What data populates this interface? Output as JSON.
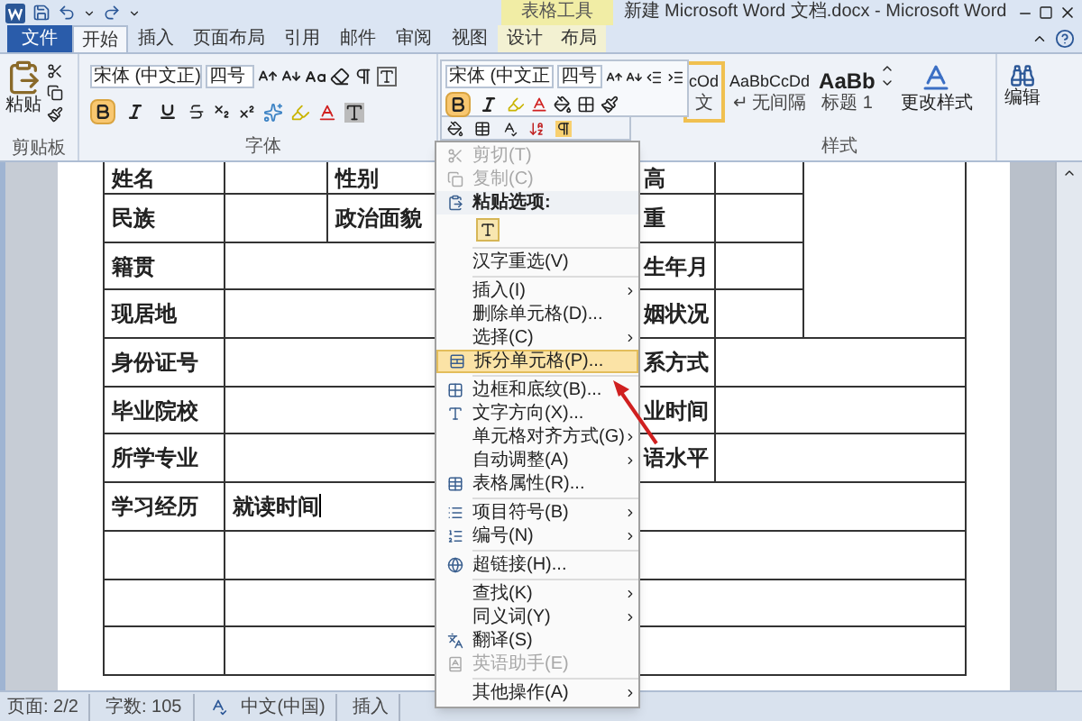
{
  "title_bar": {
    "contextual_group": "表格工具",
    "title": "新建 Microsoft Word 文档.docx - Microsoft Word"
  },
  "tabs": [
    {
      "label": "文件",
      "kind": "file",
      "selected": false
    },
    {
      "label": "开始",
      "kind": "normal",
      "selected": true
    },
    {
      "label": "插入",
      "kind": "normal",
      "selected": false
    },
    {
      "label": "页面布局",
      "kind": "normal",
      "selected": false
    },
    {
      "label": "引用",
      "kind": "normal",
      "selected": false
    },
    {
      "label": "邮件",
      "kind": "normal",
      "selected": false
    },
    {
      "label": "审阅",
      "kind": "normal",
      "selected": false
    },
    {
      "label": "视图",
      "kind": "normal",
      "selected": false
    },
    {
      "label": "设计",
      "kind": "contextual",
      "selected": false
    },
    {
      "label": "布局",
      "kind": "contextual",
      "selected": false
    }
  ],
  "ribbon": {
    "clipboard": {
      "paste": "粘贴",
      "group_label": "剪贴板"
    },
    "font": {
      "font_name": "宋体 (中文正)",
      "font_size": "四号",
      "group_label": "字体",
      "buttons": [
        {
          "kind": "bold",
          "selected": true
        },
        {
          "kind": "italic",
          "selected": false
        },
        {
          "kind": "underline",
          "selected": false
        }
      ]
    },
    "styles": {
      "items": [
        {
          "preview": "cOd",
          "name": "文",
          "selected": true
        },
        {
          "preview": "AaBbCcDd",
          "name": "↵ 无间隔",
          "selected": false
        },
        {
          "preview": "AaBb",
          "name": "标题 1",
          "selected": false
        }
      ],
      "change_styles": "更改样式",
      "group_label": "样式"
    },
    "editing": {
      "label": "编辑"
    }
  },
  "mini_toolbar": {
    "font_name": "宋体 (中文正",
    "font_size": "四号",
    "buttons": [
      {
        "kind": "bold",
        "selected": true
      },
      {
        "kind": "italic",
        "selected": false
      }
    ]
  },
  "context_menu": [
    {
      "kind": "item",
      "label": "剪切(T)",
      "disabled": true,
      "submenu": false,
      "selected": false
    },
    {
      "kind": "item",
      "label": "复制(C)",
      "disabled": true,
      "submenu": false,
      "selected": false
    },
    {
      "kind": "header",
      "label": "粘贴选项:"
    },
    {
      "kind": "paste_options"
    },
    {
      "kind": "separator"
    },
    {
      "kind": "item",
      "label": "汉字重选(V)",
      "disabled": false,
      "submenu": false,
      "selected": false
    },
    {
      "kind": "separator"
    },
    {
      "kind": "item",
      "label": "插入(I)",
      "disabled": false,
      "submenu": true,
      "selected": false
    },
    {
      "kind": "item",
      "label": "删除单元格(D)...",
      "disabled": false,
      "submenu": false,
      "selected": false
    },
    {
      "kind": "item",
      "label": "选择(C)",
      "disabled": false,
      "submenu": true,
      "selected": false
    },
    {
      "kind": "item",
      "label": "拆分单元格(P)...",
      "disabled": false,
      "submenu": false,
      "selected": true
    },
    {
      "kind": "separator"
    },
    {
      "kind": "item",
      "label": "边框和底纹(B)...",
      "disabled": false,
      "submenu": false,
      "selected": false
    },
    {
      "kind": "item",
      "label": "文字方向(X)...",
      "disabled": false,
      "submenu": false,
      "selected": false
    },
    {
      "kind": "item",
      "label": "单元格对齐方式(G)",
      "disabled": false,
      "submenu": true,
      "selected": false
    },
    {
      "kind": "item",
      "label": "自动调整(A)",
      "disabled": false,
      "submenu": true,
      "selected": false
    },
    {
      "kind": "item",
      "label": "表格属性(R)...",
      "disabled": false,
      "submenu": false,
      "selected": false
    },
    {
      "kind": "separator"
    },
    {
      "kind": "item",
      "label": "项目符号(B)",
      "disabled": false,
      "submenu": true,
      "selected": false
    },
    {
      "kind": "item",
      "label": "编号(N)",
      "disabled": false,
      "submenu": true,
      "selected": false
    },
    {
      "kind": "separator"
    },
    {
      "kind": "item",
      "label": "超链接(H)...",
      "disabled": false,
      "submenu": false,
      "selected": false
    },
    {
      "kind": "separator"
    },
    {
      "kind": "item",
      "label": "查找(K)",
      "disabled": false,
      "submenu": true,
      "selected": false
    },
    {
      "kind": "item",
      "label": "同义词(Y)",
      "disabled": false,
      "submenu": true,
      "selected": false
    },
    {
      "kind": "item",
      "label": "翻译(S)",
      "disabled": false,
      "submenu": false,
      "selected": false
    },
    {
      "kind": "item",
      "label": "英语助手(E)",
      "disabled": true,
      "submenu": false,
      "selected": false
    },
    {
      "kind": "separator"
    },
    {
      "kind": "item",
      "label": "其他操作(A)",
      "disabled": false,
      "submenu": true,
      "selected": false
    }
  ],
  "table": {
    "rows": [
      {
        "kind": "info4",
        "label": "姓名",
        "label2": "性别",
        "label3": "高"
      },
      {
        "kind": "info4",
        "label": "民族",
        "label2": "政治面貌",
        "label3": "重"
      },
      {
        "kind": "info3_photo",
        "label": "籍贯",
        "label3": "生年月"
      },
      {
        "kind": "info3_photo",
        "label": "现居地",
        "label3": "姻状况"
      },
      {
        "kind": "info3",
        "label": "身份证号",
        "label3": "系方式"
      },
      {
        "kind": "info3",
        "label": "毕业院校",
        "label3": "业时间"
      },
      {
        "kind": "info3",
        "label": "所学专业",
        "label3": "语水平"
      },
      {
        "kind": "wide",
        "label": "学习经历",
        "value": "就读时间"
      },
      {
        "kind": "wide"
      },
      {
        "kind": "wide"
      },
      {
        "kind": "wide"
      }
    ]
  },
  "status_bar": [
    "页面: 2/2",
    "字数: 105",
    "中文(中国)",
    "插入"
  ]
}
